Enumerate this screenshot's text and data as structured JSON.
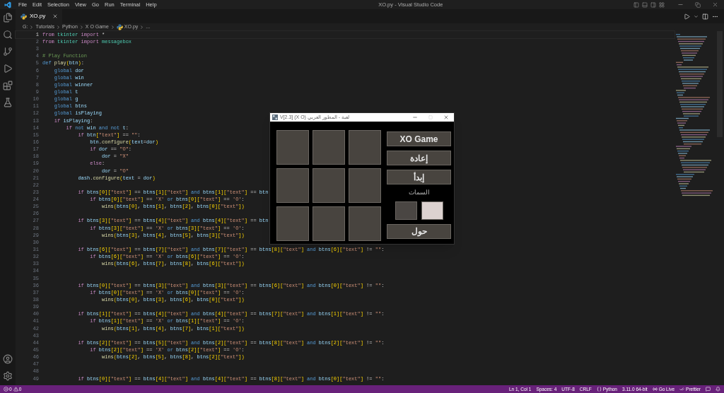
{
  "title_bar": {
    "menus": [
      "File",
      "Edit",
      "Selection",
      "View",
      "Go",
      "Run",
      "Terminal",
      "Help"
    ],
    "title": "XO.py - Visual Studio Code"
  },
  "tabs": [
    {
      "label": "XO.py",
      "selected": true
    }
  ],
  "breadcrumb": [
    "G:",
    "Tutorials",
    "Python",
    "X O Game",
    "XO.py",
    "..."
  ],
  "code_lines": [
    {
      "number": "1",
      "active": true,
      "tokens": [
        {
          "kind": "k",
          "text": "from"
        },
        {
          "kind": "m",
          "text": " tkinter"
        },
        {
          "kind": "k",
          "text": " import"
        },
        {
          "kind": "p",
          "text": " *"
        }
      ]
    },
    {
      "number": "2",
      "active": false,
      "tokens": [
        {
          "kind": "k",
          "text": "from"
        },
        {
          "kind": "m",
          "text": " tkinter"
        },
        {
          "kind": "k",
          "text": " import"
        },
        {
          "kind": "m",
          "text": " messagebox"
        }
      ]
    },
    {
      "number": "3",
      "active": false
    },
    {
      "number": "4",
      "active": false,
      "tokens": [
        {
          "kind": "c",
          "text": "# Play Function"
        }
      ]
    },
    {
      "number": "5",
      "active": false,
      "tokens": [
        {
          "kind": "s",
          "text": "def"
        },
        {
          "kind": "f",
          "text": " play"
        },
        {
          "kind": "b",
          "text": "("
        },
        {
          "kind": "v",
          "text": "btn"
        },
        {
          "kind": "b",
          "text": ")"
        },
        {
          "kind": "p",
          "text": ":"
        }
      ]
    },
    {
      "number": "6",
      "active": false,
      "tokens": [
        {
          "kind": "s",
          "text": "    global"
        },
        {
          "kind": "v",
          "text": " dor"
        }
      ]
    },
    {
      "number": "7",
      "active": false,
      "tokens": [
        {
          "kind": "s",
          "text": "    global"
        },
        {
          "kind": "v",
          "text": " win"
        }
      ]
    },
    {
      "number": "8",
      "active": false,
      "tokens": [
        {
          "kind": "s",
          "text": "    global"
        },
        {
          "kind": "v",
          "text": " winner"
        }
      ]
    },
    {
      "number": "9",
      "active": false,
      "tokens": [
        {
          "kind": "s",
          "text": "    global"
        },
        {
          "kind": "v",
          "text": " t"
        }
      ]
    },
    {
      "number": "10",
      "active": false,
      "tokens": [
        {
          "kind": "s",
          "text": "    global"
        },
        {
          "kind": "v",
          "text": " g"
        }
      ]
    },
    {
      "number": "11",
      "active": false,
      "tokens": [
        {
          "kind": "s",
          "text": "    global"
        },
        {
          "kind": "v",
          "text": " btns"
        }
      ]
    },
    {
      "number": "12",
      "active": false,
      "tokens": [
        {
          "kind": "s",
          "text": "    global"
        },
        {
          "kind": "v",
          "text": " isPlaying"
        }
      ]
    },
    {
      "number": "13",
      "active": false,
      "tokens": [
        {
          "kind": "k",
          "text": "    if"
        },
        {
          "kind": "v",
          "text": " isPlaying"
        },
        {
          "kind": "p",
          "text": ":"
        }
      ]
    },
    {
      "number": "14",
      "active": false,
      "tokens": [
        {
          "kind": "k",
          "text": "        if"
        },
        {
          "kind": "s",
          "text": " not"
        },
        {
          "kind": "v",
          "text": " win"
        },
        {
          "kind": "s",
          "text": " and not"
        },
        {
          "kind": "v",
          "text": " t"
        },
        {
          "kind": "p",
          "text": ":"
        }
      ]
    },
    {
      "number": "15",
      "active": false,
      "tokens": [
        {
          "kind": "k",
          "text": "            if"
        },
        {
          "kind": "v",
          "text": " btn"
        },
        {
          "kind": "b",
          "text": "["
        },
        {
          "kind": "t",
          "text": "\"text\""
        },
        {
          "kind": "b",
          "text": "]"
        },
        {
          "kind": "p",
          "text": " =="
        },
        {
          "kind": "t",
          "text": " \"\""
        },
        {
          "kind": "p",
          "text": ":"
        }
      ]
    },
    {
      "number": "16",
      "active": false,
      "tokens": [
        {
          "kind": "v",
          "text": "                btn"
        },
        {
          "kind": "p",
          "text": "."
        },
        {
          "kind": "f",
          "text": "configure"
        },
        {
          "kind": "b",
          "text": "("
        },
        {
          "kind": "v",
          "text": "text"
        },
        {
          "kind": "p",
          "text": "="
        },
        {
          "kind": "v",
          "text": "dor"
        },
        {
          "kind": "b",
          "text": ")"
        }
      ]
    },
    {
      "number": "17",
      "active": false,
      "tokens": [
        {
          "kind": "k",
          "text": "                if"
        },
        {
          "kind": "v",
          "text": " dor"
        },
        {
          "kind": "p",
          "text": " =="
        },
        {
          "kind": "t",
          "text": " \"O\""
        },
        {
          "kind": "p",
          "text": ":"
        }
      ]
    },
    {
      "number": "18",
      "active": false,
      "tokens": [
        {
          "kind": "v",
          "text": "                    dor"
        },
        {
          "kind": "p",
          "text": " ="
        },
        {
          "kind": "t",
          "text": " \"X\""
        }
      ]
    },
    {
      "number": "19",
      "active": false,
      "tokens": [
        {
          "kind": "k",
          "text": "                else"
        },
        {
          "kind": "p",
          "text": ":"
        }
      ]
    },
    {
      "number": "20",
      "active": false,
      "tokens": [
        {
          "kind": "v",
          "text": "                    dor"
        },
        {
          "kind": "p",
          "text": " ="
        },
        {
          "kind": "t",
          "text": " \"O\""
        }
      ]
    },
    {
      "number": "21",
      "active": false,
      "tokens": [
        {
          "kind": "v",
          "text": "            dash"
        },
        {
          "kind": "p",
          "text": "."
        },
        {
          "kind": "f",
          "text": "configure"
        },
        {
          "kind": "b",
          "text": "("
        },
        {
          "kind": "v",
          "text": "text"
        },
        {
          "kind": "p",
          "text": " ="
        },
        {
          "kind": "v",
          "text": " dor"
        },
        {
          "kind": "b",
          "text": ")"
        }
      ]
    },
    {
      "number": "22",
      "active": false
    },
    {
      "number": "23",
      "active": false,
      "tokens": [
        {
          "kind": "k",
          "text": "            if"
        },
        {
          "kind": "v",
          "text": " btns"
        },
        {
          "kind": "b",
          "text": "[0]["
        },
        {
          "kind": "t",
          "text": "\"text\""
        },
        {
          "kind": "b",
          "text": "]"
        },
        {
          "kind": "p",
          "text": " =="
        },
        {
          "kind": "v",
          "text": " btns"
        },
        {
          "kind": "b",
          "text": "[1]["
        },
        {
          "kind": "t",
          "text": "\"text\""
        },
        {
          "kind": "b",
          "text": "]"
        },
        {
          "kind": "s",
          "text": " and"
        },
        {
          "kind": "v",
          "text": " btns"
        },
        {
          "kind": "b",
          "text": "[1]["
        },
        {
          "kind": "t",
          "text": "\"text\""
        },
        {
          "kind": "b",
          "text": "]"
        },
        {
          "kind": "p",
          "text": " =="
        },
        {
          "kind": "v",
          "text": " btn"
        }
      ]
    },
    {
      "number": "24",
      "active": false,
      "tokens": [
        {
          "kind": "k",
          "text": "                if"
        },
        {
          "kind": "v",
          "text": " btns"
        },
        {
          "kind": "b",
          "text": "[0]["
        },
        {
          "kind": "t",
          "text": "\"text\""
        },
        {
          "kind": "b",
          "text": "]"
        },
        {
          "kind": "p",
          "text": " =="
        },
        {
          "kind": "t",
          "text": " 'X'"
        },
        {
          "kind": "s",
          "text": " or"
        },
        {
          "kind": "v",
          "text": " btns"
        },
        {
          "kind": "b",
          "text": "[0]["
        },
        {
          "kind": "t",
          "text": "\"text\""
        },
        {
          "kind": "b",
          "text": "]"
        },
        {
          "kind": "p",
          "text": " =="
        },
        {
          "kind": "t",
          "text": " 'O'"
        },
        {
          "kind": "p",
          "text": ":"
        }
      ]
    },
    {
      "number": "25",
      "active": false,
      "tokens": [
        {
          "kind": "f",
          "text": "                    wins"
        },
        {
          "kind": "b",
          "text": "("
        },
        {
          "kind": "v",
          "text": "btns"
        },
        {
          "kind": "b",
          "text": "[0]"
        },
        {
          "kind": "p",
          "text": ","
        },
        {
          "kind": "v",
          "text": " btns"
        },
        {
          "kind": "b",
          "text": "[1]"
        },
        {
          "kind": "p",
          "text": ","
        },
        {
          "kind": "v",
          "text": " btns"
        },
        {
          "kind": "b",
          "text": "[2]"
        },
        {
          "kind": "p",
          "text": ","
        },
        {
          "kind": "v",
          "text": " btns"
        },
        {
          "kind": "b",
          "text": "[0]["
        },
        {
          "kind": "t",
          "text": "\"text\""
        },
        {
          "kind": "b",
          "text": "])"
        }
      ]
    },
    {
      "number": "26",
      "active": false
    },
    {
      "number": "27",
      "active": false,
      "tokens": [
        {
          "kind": "k",
          "text": "            if"
        },
        {
          "kind": "v",
          "text": " btns"
        },
        {
          "kind": "b",
          "text": "[3]["
        },
        {
          "kind": "t",
          "text": "\"text\""
        },
        {
          "kind": "b",
          "text": "]"
        },
        {
          "kind": "p",
          "text": " =="
        },
        {
          "kind": "v",
          "text": " btns"
        },
        {
          "kind": "b",
          "text": "[4]["
        },
        {
          "kind": "t",
          "text": "\"text\""
        },
        {
          "kind": "b",
          "text": "]"
        },
        {
          "kind": "s",
          "text": " and"
        },
        {
          "kind": "v",
          "text": " btns"
        },
        {
          "kind": "b",
          "text": "[4]["
        },
        {
          "kind": "t",
          "text": "\"text\""
        },
        {
          "kind": "b",
          "text": "]"
        },
        {
          "kind": "p",
          "text": " =="
        },
        {
          "kind": "v",
          "text": " btn"
        }
      ]
    },
    {
      "number": "28",
      "active": false,
      "tokens": [
        {
          "kind": "k",
          "text": "                if"
        },
        {
          "kind": "v",
          "text": " btns"
        },
        {
          "kind": "b",
          "text": "[3]["
        },
        {
          "kind": "t",
          "text": "\"text\""
        },
        {
          "kind": "b",
          "text": "]"
        },
        {
          "kind": "p",
          "text": " =="
        },
        {
          "kind": "t",
          "text": " 'X'"
        },
        {
          "kind": "s",
          "text": " or"
        },
        {
          "kind": "v",
          "text": " btns"
        },
        {
          "kind": "b",
          "text": "[3]["
        },
        {
          "kind": "t",
          "text": "\"text\""
        },
        {
          "kind": "b",
          "text": "]"
        },
        {
          "kind": "p",
          "text": " =="
        },
        {
          "kind": "t",
          "text": " 'O'"
        },
        {
          "kind": "p",
          "text": ":"
        }
      ]
    },
    {
      "number": "29",
      "active": false,
      "tokens": [
        {
          "kind": "f",
          "text": "                    wins"
        },
        {
          "kind": "b",
          "text": "("
        },
        {
          "kind": "v",
          "text": "btns"
        },
        {
          "kind": "b",
          "text": "[3]"
        },
        {
          "kind": "p",
          "text": ","
        },
        {
          "kind": "v",
          "text": " btns"
        },
        {
          "kind": "b",
          "text": "[4]"
        },
        {
          "kind": "p",
          "text": ","
        },
        {
          "kind": "v",
          "text": " btns"
        },
        {
          "kind": "b",
          "text": "[5]"
        },
        {
          "kind": "p",
          "text": ","
        },
        {
          "kind": "v",
          "text": " btns"
        },
        {
          "kind": "b",
          "text": "[3]["
        },
        {
          "kind": "t",
          "text": "\"text\""
        },
        {
          "kind": "b",
          "text": "])"
        }
      ]
    },
    {
      "number": "30",
      "active": false
    },
    {
      "number": "31",
      "active": false,
      "tokens": [
        {
          "kind": "k",
          "text": "            if"
        },
        {
          "kind": "v",
          "text": " btns"
        },
        {
          "kind": "b",
          "text": "[6]["
        },
        {
          "kind": "t",
          "text": "\"text\""
        },
        {
          "kind": "b",
          "text": "]"
        },
        {
          "kind": "p",
          "text": " =="
        },
        {
          "kind": "v",
          "text": " btns"
        },
        {
          "kind": "b",
          "text": "[7]["
        },
        {
          "kind": "t",
          "text": "\"text\""
        },
        {
          "kind": "b",
          "text": "]"
        },
        {
          "kind": "s",
          "text": " and"
        },
        {
          "kind": "v",
          "text": " btns"
        },
        {
          "kind": "b",
          "text": "[7]["
        },
        {
          "kind": "t",
          "text": "\"text\""
        },
        {
          "kind": "b",
          "text": "]"
        },
        {
          "kind": "p",
          "text": " =="
        },
        {
          "kind": "v",
          "text": " btns"
        },
        {
          "kind": "b",
          "text": "[8]["
        },
        {
          "kind": "t",
          "text": "\"text\""
        },
        {
          "kind": "b",
          "text": "]"
        },
        {
          "kind": "s",
          "text": " and"
        },
        {
          "kind": "v",
          "text": " btns"
        },
        {
          "kind": "b",
          "text": "[6]["
        },
        {
          "kind": "t",
          "text": "\"text\""
        },
        {
          "kind": "b",
          "text": "]"
        },
        {
          "kind": "p",
          "text": " !="
        },
        {
          "kind": "t",
          "text": " \"\""
        },
        {
          "kind": "p",
          "text": ":"
        }
      ]
    },
    {
      "number": "32",
      "active": false,
      "tokens": [
        {
          "kind": "k",
          "text": "                if"
        },
        {
          "kind": "v",
          "text": " btns"
        },
        {
          "kind": "b",
          "text": "[6]["
        },
        {
          "kind": "t",
          "text": "\"text\""
        },
        {
          "kind": "b",
          "text": "]"
        },
        {
          "kind": "p",
          "text": " =="
        },
        {
          "kind": "t",
          "text": " 'X'"
        },
        {
          "kind": "s",
          "text": " or"
        },
        {
          "kind": "v",
          "text": " btns"
        },
        {
          "kind": "b",
          "text": "[6]["
        },
        {
          "kind": "t",
          "text": "\"text\""
        },
        {
          "kind": "b",
          "text": "]"
        },
        {
          "kind": "p",
          "text": " =="
        },
        {
          "kind": "t",
          "text": " 'O'"
        },
        {
          "kind": "p",
          "text": ":"
        }
      ]
    },
    {
      "number": "33",
      "active": false,
      "tokens": [
        {
          "kind": "f",
          "text": "                    wins"
        },
        {
          "kind": "b",
          "text": "("
        },
        {
          "kind": "v",
          "text": "btns"
        },
        {
          "kind": "b",
          "text": "[6]"
        },
        {
          "kind": "p",
          "text": ","
        },
        {
          "kind": "v",
          "text": " btns"
        },
        {
          "kind": "b",
          "text": "[7]"
        },
        {
          "kind": "p",
          "text": ","
        },
        {
          "kind": "v",
          "text": " btns"
        },
        {
          "kind": "b",
          "text": "[8]"
        },
        {
          "kind": "p",
          "text": ","
        },
        {
          "kind": "v",
          "text": " btns"
        },
        {
          "kind": "b",
          "text": "[6]["
        },
        {
          "kind": "t",
          "text": "\"text\""
        },
        {
          "kind": "b",
          "text": "])"
        }
      ]
    },
    {
      "number": "34",
      "active": false
    },
    {
      "number": "35",
      "active": false
    },
    {
      "number": "36",
      "active": false,
      "tokens": [
        {
          "kind": "k",
          "text": "            if"
        },
        {
          "kind": "v",
          "text": " btns"
        },
        {
          "kind": "b",
          "text": "[0]["
        },
        {
          "kind": "t",
          "text": "\"text\""
        },
        {
          "kind": "b",
          "text": "]"
        },
        {
          "kind": "p",
          "text": " =="
        },
        {
          "kind": "v",
          "text": " btns"
        },
        {
          "kind": "b",
          "text": "[3]["
        },
        {
          "kind": "t",
          "text": "\"text\""
        },
        {
          "kind": "b",
          "text": "]"
        },
        {
          "kind": "s",
          "text": " and"
        },
        {
          "kind": "v",
          "text": " btns"
        },
        {
          "kind": "b",
          "text": "[3]["
        },
        {
          "kind": "t",
          "text": "\"text\""
        },
        {
          "kind": "b",
          "text": "]"
        },
        {
          "kind": "p",
          "text": " =="
        },
        {
          "kind": "v",
          "text": " btns"
        },
        {
          "kind": "b",
          "text": "[6]["
        },
        {
          "kind": "t",
          "text": "\"text\""
        },
        {
          "kind": "b",
          "text": "]"
        },
        {
          "kind": "s",
          "text": " and"
        },
        {
          "kind": "v",
          "text": " btns"
        },
        {
          "kind": "b",
          "text": "[0]["
        },
        {
          "kind": "t",
          "text": "\"text\""
        },
        {
          "kind": "b",
          "text": "]"
        },
        {
          "kind": "p",
          "text": " !="
        },
        {
          "kind": "t",
          "text": " \"\""
        },
        {
          "kind": "p",
          "text": ":"
        }
      ]
    },
    {
      "number": "37",
      "active": false,
      "tokens": [
        {
          "kind": "k",
          "text": "                if"
        },
        {
          "kind": "v",
          "text": " btns"
        },
        {
          "kind": "b",
          "text": "[0]["
        },
        {
          "kind": "t",
          "text": "\"text\""
        },
        {
          "kind": "b",
          "text": "]"
        },
        {
          "kind": "p",
          "text": " =="
        },
        {
          "kind": "t",
          "text": " 'X'"
        },
        {
          "kind": "s",
          "text": " or"
        },
        {
          "kind": "v",
          "text": " btns"
        },
        {
          "kind": "b",
          "text": "[0]["
        },
        {
          "kind": "t",
          "text": "\"text\""
        },
        {
          "kind": "b",
          "text": "]"
        },
        {
          "kind": "p",
          "text": " =="
        },
        {
          "kind": "t",
          "text": " 'O'"
        },
        {
          "kind": "p",
          "text": ":"
        }
      ]
    },
    {
      "number": "38",
      "active": false,
      "tokens": [
        {
          "kind": "f",
          "text": "                    wins"
        },
        {
          "kind": "b",
          "text": "("
        },
        {
          "kind": "v",
          "text": "btns"
        },
        {
          "kind": "b",
          "text": "[0]"
        },
        {
          "kind": "p",
          "text": ","
        },
        {
          "kind": "v",
          "text": " btns"
        },
        {
          "kind": "b",
          "text": "[3]"
        },
        {
          "kind": "p",
          "text": ","
        },
        {
          "kind": "v",
          "text": " btns"
        },
        {
          "kind": "b",
          "text": "[6]"
        },
        {
          "kind": "p",
          "text": ","
        },
        {
          "kind": "v",
          "text": " btns"
        },
        {
          "kind": "b",
          "text": "[0]["
        },
        {
          "kind": "t",
          "text": "\"text\""
        },
        {
          "kind": "b",
          "text": "])"
        }
      ]
    },
    {
      "number": "39",
      "active": false
    },
    {
      "number": "40",
      "active": false,
      "tokens": [
        {
          "kind": "k",
          "text": "            if"
        },
        {
          "kind": "v",
          "text": " btns"
        },
        {
          "kind": "b",
          "text": "[1]["
        },
        {
          "kind": "t",
          "text": "\"text\""
        },
        {
          "kind": "b",
          "text": "]"
        },
        {
          "kind": "p",
          "text": " =="
        },
        {
          "kind": "v",
          "text": " btns"
        },
        {
          "kind": "b",
          "text": "[4]["
        },
        {
          "kind": "t",
          "text": "\"text\""
        },
        {
          "kind": "b",
          "text": "]"
        },
        {
          "kind": "s",
          "text": " and"
        },
        {
          "kind": "v",
          "text": " btns"
        },
        {
          "kind": "b",
          "text": "[4]["
        },
        {
          "kind": "t",
          "text": "\"text\""
        },
        {
          "kind": "b",
          "text": "]"
        },
        {
          "kind": "p",
          "text": " =="
        },
        {
          "kind": "v",
          "text": " btns"
        },
        {
          "kind": "b",
          "text": "[7]["
        },
        {
          "kind": "t",
          "text": "\"text\""
        },
        {
          "kind": "b",
          "text": "]"
        },
        {
          "kind": "s",
          "text": " and"
        },
        {
          "kind": "v",
          "text": " btns"
        },
        {
          "kind": "b",
          "text": "[1]["
        },
        {
          "kind": "t",
          "text": "\"text\""
        },
        {
          "kind": "b",
          "text": "]"
        },
        {
          "kind": "p",
          "text": " !="
        },
        {
          "kind": "t",
          "text": " \"\""
        },
        {
          "kind": "p",
          "text": ":"
        }
      ]
    },
    {
      "number": "41",
      "active": false,
      "tokens": [
        {
          "kind": "k",
          "text": "                if"
        },
        {
          "kind": "v",
          "text": " btns"
        },
        {
          "kind": "b",
          "text": "[1]["
        },
        {
          "kind": "t",
          "text": "\"text\""
        },
        {
          "kind": "b",
          "text": "]"
        },
        {
          "kind": "p",
          "text": " =="
        },
        {
          "kind": "t",
          "text": " 'X'"
        },
        {
          "kind": "s",
          "text": " or"
        },
        {
          "kind": "v",
          "text": " btns"
        },
        {
          "kind": "b",
          "text": "[1]["
        },
        {
          "kind": "t",
          "text": "\"text\""
        },
        {
          "kind": "b",
          "text": "]"
        },
        {
          "kind": "p",
          "text": " =="
        },
        {
          "kind": "t",
          "text": " 'O'"
        },
        {
          "kind": "p",
          "text": ":"
        }
      ]
    },
    {
      "number": "42",
      "active": false,
      "tokens": [
        {
          "kind": "f",
          "text": "                    wins"
        },
        {
          "kind": "b",
          "text": "("
        },
        {
          "kind": "v",
          "text": "btns"
        },
        {
          "kind": "b",
          "text": "[1]"
        },
        {
          "kind": "p",
          "text": ","
        },
        {
          "kind": "v",
          "text": " btns"
        },
        {
          "kind": "b",
          "text": "[4]"
        },
        {
          "kind": "p",
          "text": ","
        },
        {
          "kind": "v",
          "text": " btns"
        },
        {
          "kind": "b",
          "text": "[7]"
        },
        {
          "kind": "p",
          "text": ","
        },
        {
          "kind": "v",
          "text": " btns"
        },
        {
          "kind": "b",
          "text": "[1]["
        },
        {
          "kind": "t",
          "text": "\"text\""
        },
        {
          "kind": "b",
          "text": "])"
        }
      ]
    },
    {
      "number": "43",
      "active": false
    },
    {
      "number": "44",
      "active": false,
      "tokens": [
        {
          "kind": "k",
          "text": "            if"
        },
        {
          "kind": "v",
          "text": " btns"
        },
        {
          "kind": "b",
          "text": "[2]["
        },
        {
          "kind": "t",
          "text": "\"text\""
        },
        {
          "kind": "b",
          "text": "]"
        },
        {
          "kind": "p",
          "text": " =="
        },
        {
          "kind": "v",
          "text": " btns"
        },
        {
          "kind": "b",
          "text": "[5]["
        },
        {
          "kind": "t",
          "text": "\"text\""
        },
        {
          "kind": "b",
          "text": "]"
        },
        {
          "kind": "s",
          "text": " and"
        },
        {
          "kind": "v",
          "text": " btns"
        },
        {
          "kind": "b",
          "text": "[2]["
        },
        {
          "kind": "t",
          "text": "\"text\""
        },
        {
          "kind": "b",
          "text": "]"
        },
        {
          "kind": "p",
          "text": " =="
        },
        {
          "kind": "v",
          "text": " btns"
        },
        {
          "kind": "b",
          "text": "[8]["
        },
        {
          "kind": "t",
          "text": "\"text\""
        },
        {
          "kind": "b",
          "text": "]"
        },
        {
          "kind": "s",
          "text": " and"
        },
        {
          "kind": "v",
          "text": " btns"
        },
        {
          "kind": "b",
          "text": "[2]["
        },
        {
          "kind": "t",
          "text": "\"text\""
        },
        {
          "kind": "b",
          "text": "]"
        },
        {
          "kind": "p",
          "text": " !="
        },
        {
          "kind": "t",
          "text": " \"\""
        },
        {
          "kind": "p",
          "text": ":"
        }
      ]
    },
    {
      "number": "45",
      "active": false,
      "tokens": [
        {
          "kind": "k",
          "text": "                if"
        },
        {
          "kind": "v",
          "text": " btns"
        },
        {
          "kind": "b",
          "text": "[2]["
        },
        {
          "kind": "t",
          "text": "\"text\""
        },
        {
          "kind": "b",
          "text": "]"
        },
        {
          "kind": "p",
          "text": " =="
        },
        {
          "kind": "t",
          "text": " 'X'"
        },
        {
          "kind": "s",
          "text": " or"
        },
        {
          "kind": "v",
          "text": " btns"
        },
        {
          "kind": "b",
          "text": "[2]["
        },
        {
          "kind": "t",
          "text": "\"text\""
        },
        {
          "kind": "b",
          "text": "]"
        },
        {
          "kind": "p",
          "text": " =="
        },
        {
          "kind": "t",
          "text": " 'O'"
        },
        {
          "kind": "p",
          "text": ":"
        }
      ]
    },
    {
      "number": "46",
      "active": false,
      "tokens": [
        {
          "kind": "f",
          "text": "                    wins"
        },
        {
          "kind": "b",
          "text": "("
        },
        {
          "kind": "v",
          "text": "btns"
        },
        {
          "kind": "b",
          "text": "[2]"
        },
        {
          "kind": "p",
          "text": ","
        },
        {
          "kind": "v",
          "text": " btns"
        },
        {
          "kind": "b",
          "text": "[5]"
        },
        {
          "kind": "p",
          "text": ","
        },
        {
          "kind": "v",
          "text": " btns"
        },
        {
          "kind": "b",
          "text": "[8]"
        },
        {
          "kind": "p",
          "text": ","
        },
        {
          "kind": "v",
          "text": " btns"
        },
        {
          "kind": "b",
          "text": "[2]["
        },
        {
          "kind": "t",
          "text": "\"text\""
        },
        {
          "kind": "b",
          "text": "])"
        }
      ]
    },
    {
      "number": "47",
      "active": false
    },
    {
      "number": "48",
      "active": false
    },
    {
      "number": "49",
      "active": false,
      "tokens": [
        {
          "kind": "k",
          "text": "            if"
        },
        {
          "kind": "v",
          "text": " btns"
        },
        {
          "kind": "b",
          "text": "[0]["
        },
        {
          "kind": "t",
          "text": "\"text\""
        },
        {
          "kind": "b",
          "text": "]"
        },
        {
          "kind": "p",
          "text": " =="
        },
        {
          "kind": "v",
          "text": " btns"
        },
        {
          "kind": "b",
          "text": "[4]["
        },
        {
          "kind": "t",
          "text": "\"text\""
        },
        {
          "kind": "b",
          "text": "]"
        },
        {
          "kind": "s",
          "text": " and"
        },
        {
          "kind": "v",
          "text": " btns"
        },
        {
          "kind": "b",
          "text": "[4]["
        },
        {
          "kind": "t",
          "text": "\"text\""
        },
        {
          "kind": "b",
          "text": "]"
        },
        {
          "kind": "p",
          "text": " =="
        },
        {
          "kind": "v",
          "text": " btns"
        },
        {
          "kind": "b",
          "text": "[8]["
        },
        {
          "kind": "t",
          "text": "\"text\""
        },
        {
          "kind": "b",
          "text": "]"
        },
        {
          "kind": "s",
          "text": " and"
        },
        {
          "kind": "v",
          "text": " btns"
        },
        {
          "kind": "b",
          "text": "[0]["
        },
        {
          "kind": "t",
          "text": "\"text\""
        },
        {
          "kind": "b",
          "text": "]"
        },
        {
          "kind": "p",
          "text": " !="
        },
        {
          "kind": "t",
          "text": " \"\""
        },
        {
          "kind": "p",
          "text": ":"
        }
      ]
    }
  ],
  "game_window": {
    "title": "V[2.3] (X O) لعبة - المطور العربي",
    "title_button": "XO Game",
    "restart_button": "إعادة",
    "start_button": "إبدأ",
    "themes_label": "السمات",
    "themes": [
      {
        "color": "#4a4643"
      },
      {
        "color": "#dcd2d0"
      }
    ],
    "about_button": "حول"
  },
  "status_bar": {
    "errors": "0",
    "warnings": "0",
    "position": "Ln 1, Col 1",
    "spaces": "Spaces: 4",
    "encoding": "UTF-8",
    "eol": "CRLF",
    "language": "Python",
    "interpreter": "3.11.0 64-bit",
    "go_live": "Go Live",
    "prettier": "Prettier"
  }
}
